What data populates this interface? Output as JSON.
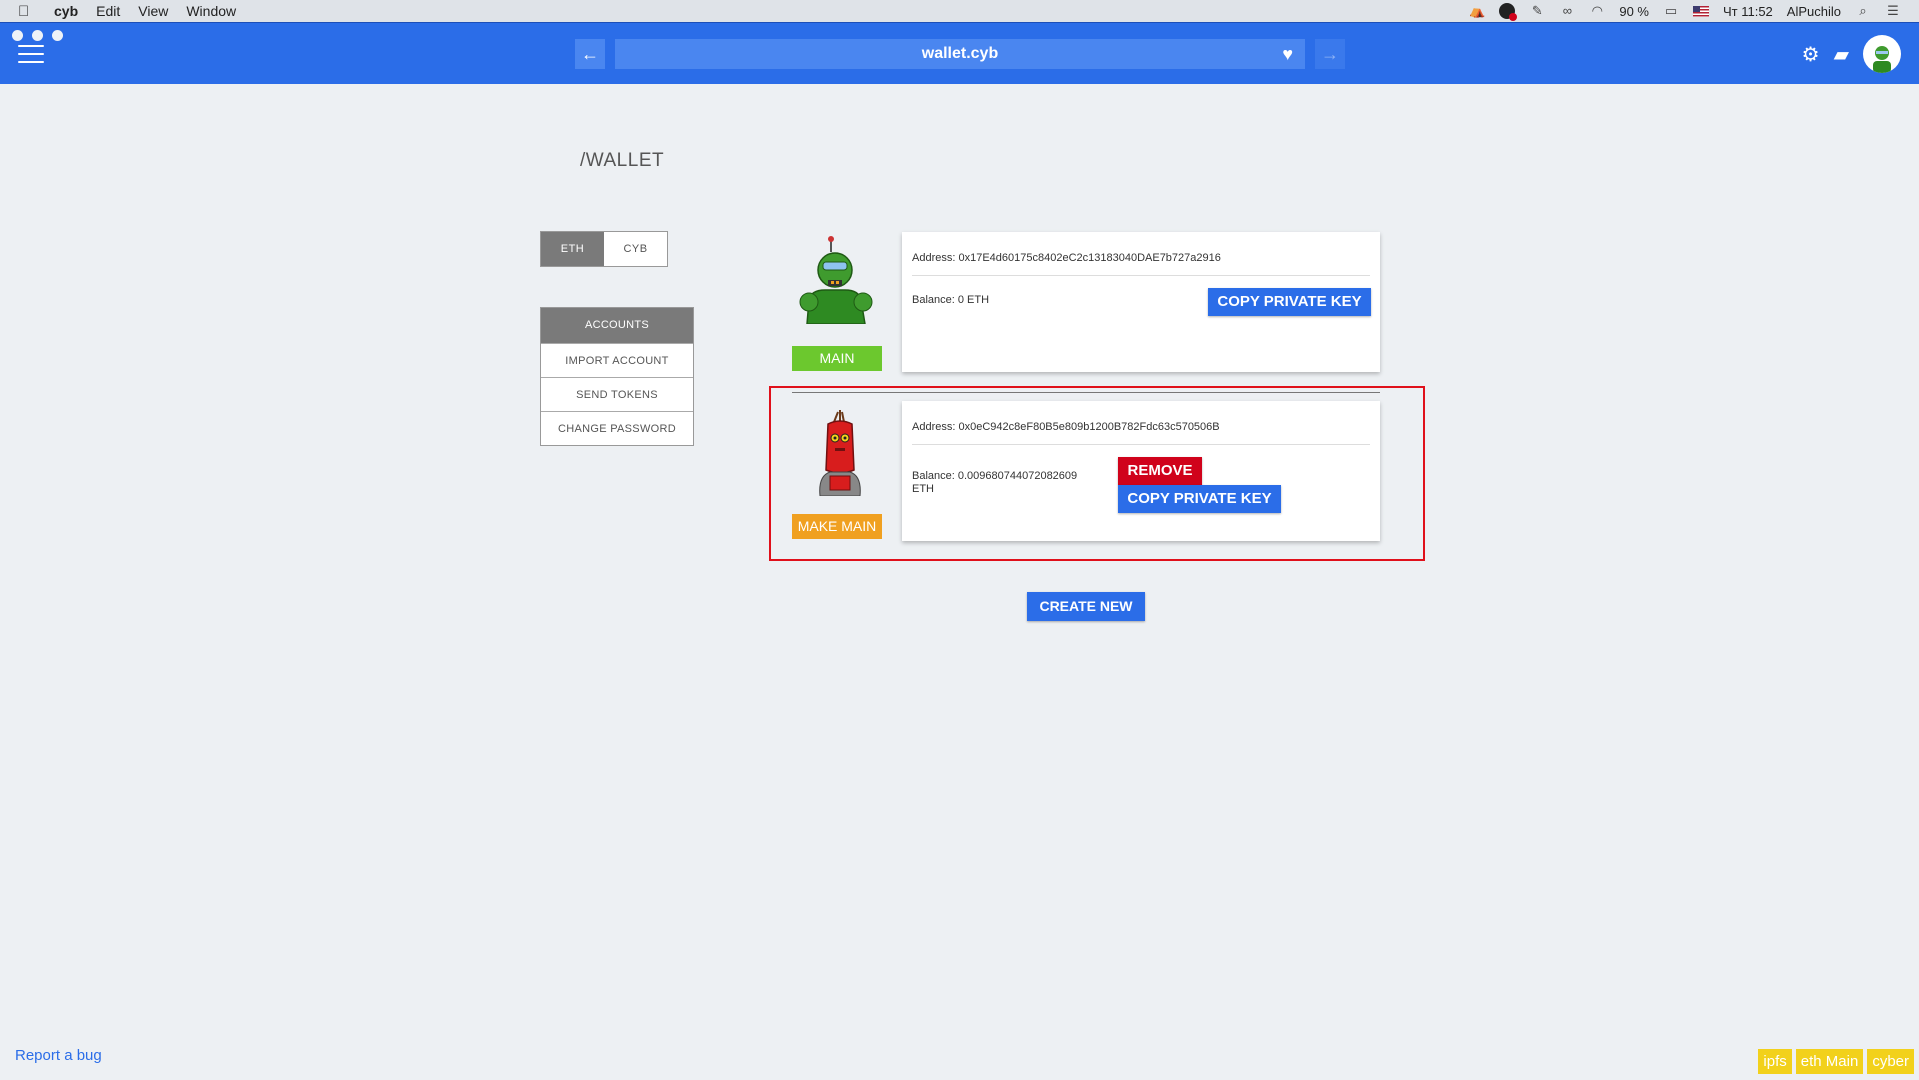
{
  "menubar": {
    "app": "cyb",
    "items": [
      "Edit",
      "View",
      "Window"
    ],
    "battery": "90 %",
    "clock": "Чт 11:52",
    "user": "AlPuchilo"
  },
  "topbar": {
    "url": "wallet.cyb",
    "back": "←",
    "forward": "→",
    "heart": "♥",
    "settings": "⚙",
    "wallet": "▰"
  },
  "page": {
    "title": "/WALLET"
  },
  "toggle": {
    "eth": "ETH",
    "cyb": "CYB"
  },
  "menu": {
    "accounts": "ACCOUNTS",
    "import": "IMPORT ACCOUNT",
    "send": "SEND TOKENS",
    "change_password": "CHANGE PASSWORD"
  },
  "accounts": [
    {
      "badge": "MAIN",
      "address": "Address: 0x17E4d60175c8402eC2c13183040DAE7b727a2916",
      "balance": "Balance: 0 ETH",
      "copy": "COPY PRIVATE KEY"
    },
    {
      "badge": "MAKE MAIN",
      "address": "Address: 0x0eC942c8eF80B5e809b1200B782Fdc63c570506B",
      "balance_line1": "Balance: 0.009680744072082609",
      "balance_line2": "ETH",
      "remove": "REMOVE",
      "copy": "COPY PRIVATE KEY"
    }
  ],
  "create_new": "CREATE NEW",
  "footer": {
    "report": "Report a bug",
    "tags": [
      "ipfs",
      "eth Main",
      "cyber"
    ]
  },
  "colors": {
    "primary": "#2b6de8",
    "main_badge": "#6cc82e",
    "make_main": "#f0a020",
    "remove": "#d0021b",
    "status": "#f2d11b"
  }
}
